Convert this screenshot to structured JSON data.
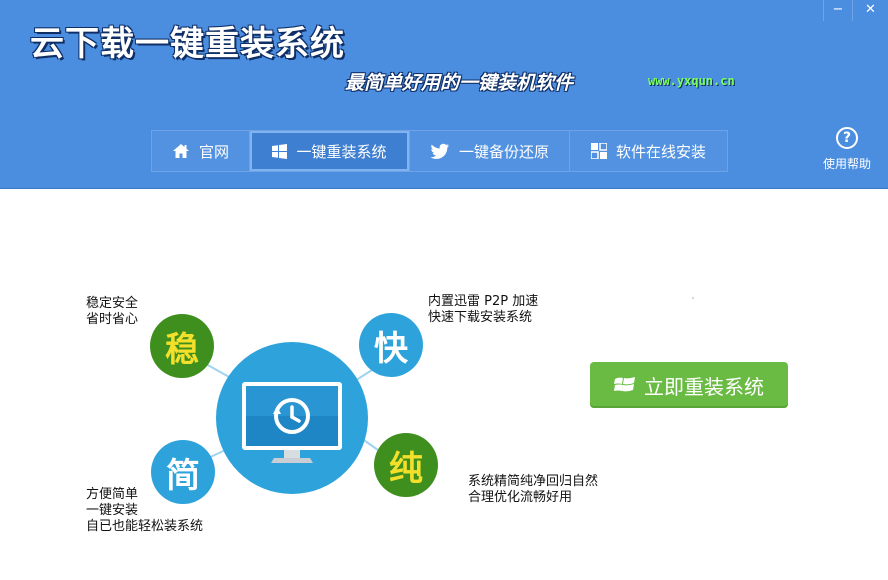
{
  "app": {
    "title": "云下载一键重装系统",
    "slogan": "最简单好用的一键装机软件",
    "url": "www.yxqun.cn"
  },
  "window_controls": {
    "minimize": "−",
    "close": "✕"
  },
  "nav": {
    "items": [
      {
        "label": "官网",
        "icon": "home-icon"
      },
      {
        "label": "一键重装系统",
        "icon": "windows-icon",
        "active": true
      },
      {
        "label": "一键备份还原",
        "icon": "bird-icon"
      },
      {
        "label": "软件在线安装",
        "icon": "app-grid-icon"
      }
    ]
  },
  "help": {
    "label": "使用帮助",
    "glyph": "?"
  },
  "features": {
    "wen": {
      "char": "稳",
      "lines": [
        "稳定安全",
        "省时省心"
      ]
    },
    "kuai": {
      "char": "快",
      "lines": [
        "内置迅雷 P2P 加速",
        "快速下载安装系统"
      ]
    },
    "chun": {
      "char": "纯",
      "lines": [
        "系统精简纯净回归自然",
        "合理优化流畅好用"
      ]
    },
    "jian": {
      "char": "简",
      "lines": [
        "方便简单",
        "一键安装",
        "自已也能轻松装系统"
      ]
    }
  },
  "install_button": {
    "label": "立即重装系统",
    "icon": "windows-icon"
  },
  "colors": {
    "header_bg": "#4b8ee0",
    "accent_blue": "#2ea3db",
    "accent_green": "#3f8f1f",
    "badge_yellow": "#f4e02a",
    "button_green": "#6abb43"
  }
}
